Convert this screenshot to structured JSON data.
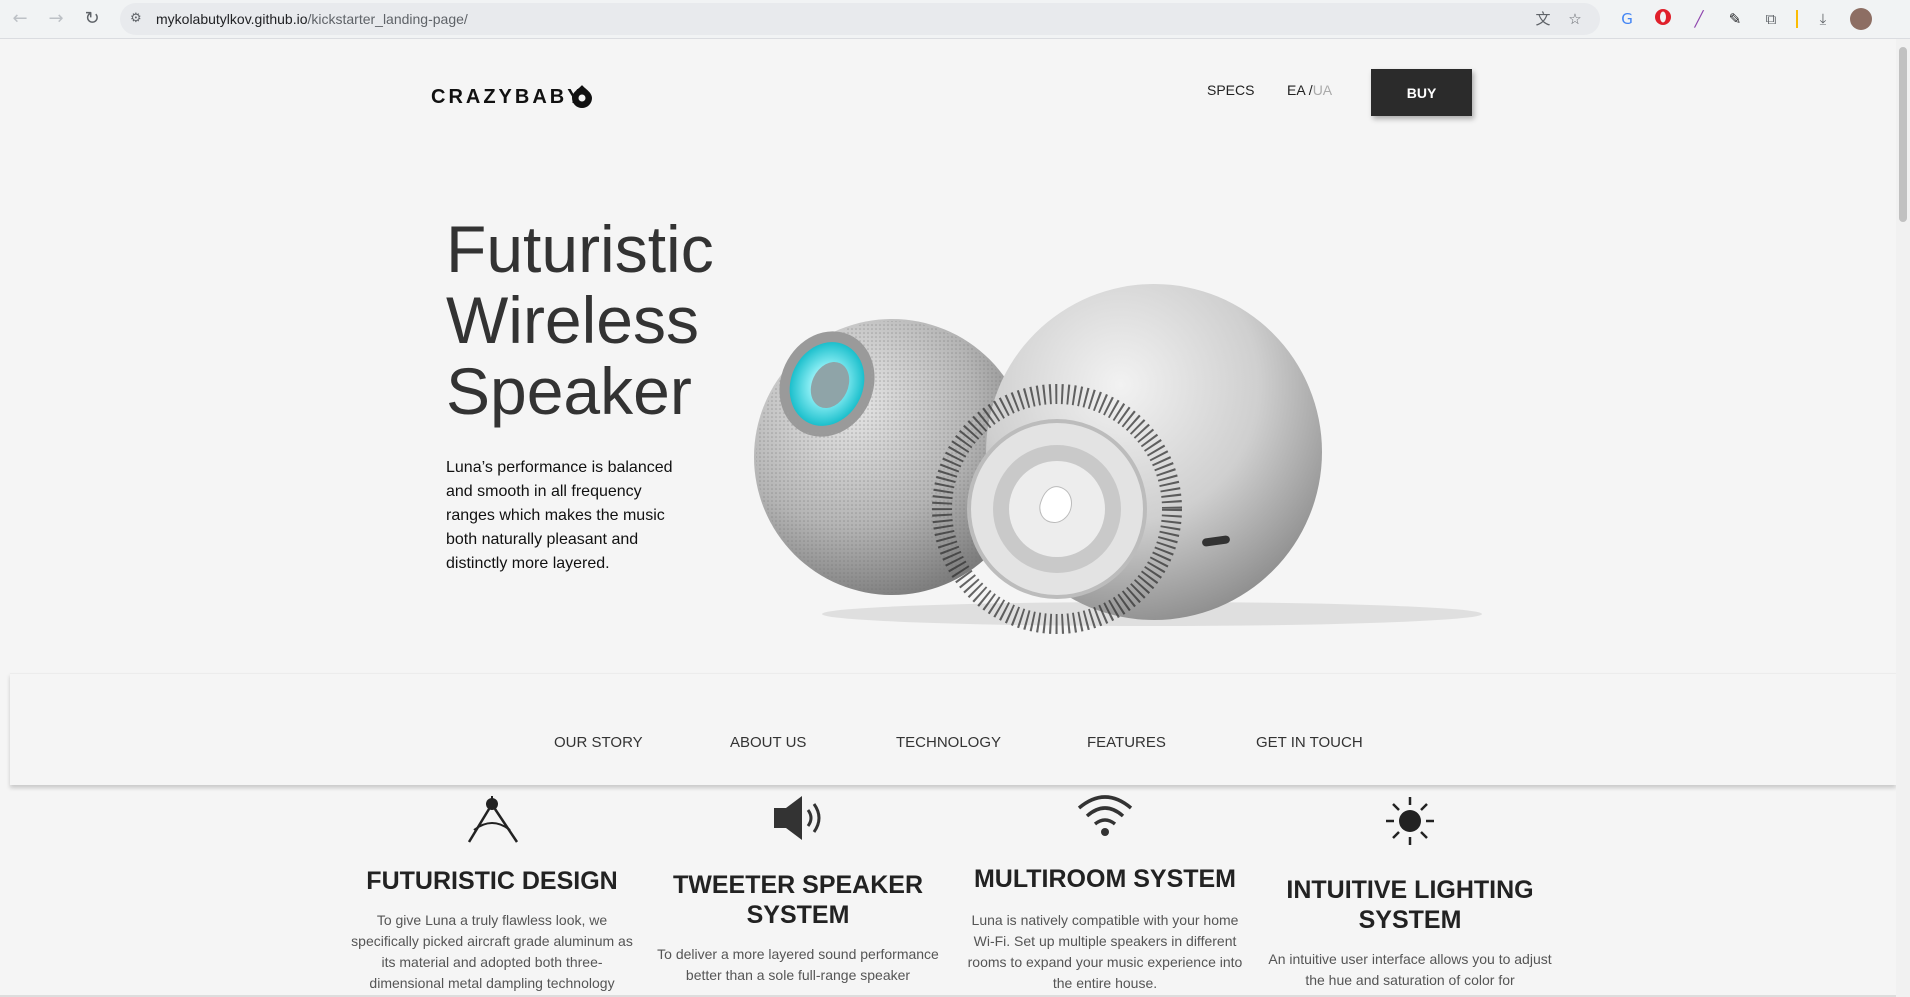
{
  "browser": {
    "url_host": "mykolabutylkov.github.io",
    "url_path": "/kickstarter_landing-page/",
    "back_icon": "arrow-left-icon",
    "forward_icon": "arrow-right-icon",
    "reload_icon": "reload-icon"
  },
  "header": {
    "logo_text": "CRAZYBABY",
    "nav_specs": "SPECS",
    "lang_ea": "EA",
    "lang_sep": "/",
    "lang_ua": "UA",
    "buy_label": "BUY"
  },
  "hero": {
    "title_line1": "Futuristic",
    "title_line2": "Wireless",
    "title_line3": "Speaker",
    "description": "Luna’s performance is balanced and smooth in all frequency ranges which makes the music both naturally pleasant and distinctly more layered."
  },
  "section_nav": {
    "items": [
      "OUR STORY",
      "ABOUT US",
      "TECHNOLOGY",
      "FEATURES",
      "GET IN TOUCH"
    ]
  },
  "features": [
    {
      "icon": "compass-icon",
      "title": "FUTURISTIC DESIGN",
      "text": "To give Luna a truly flawless look, we specifically picked aircraft grade aluminum as its material and adopted both three-dimensional metal dampling technology"
    },
    {
      "icon": "speaker-icon",
      "title": "TWEETER SPEAKER SYSTEM",
      "text": "To deliver a more layered sound performance better than a sole full-range speaker"
    },
    {
      "icon": "wifi-icon",
      "title": "MULTIROOM SYSTEM",
      "text": "Luna is natively compatible with your home Wi-Fi. Set up multiple speakers in different rooms to expand your music experience into the entire house."
    },
    {
      "icon": "sun-icon",
      "title": "INTUITIVE LIGHTING SYSTEM",
      "text": "An intuitive user interface allows you to adjust the hue and saturation of color for"
    }
  ]
}
